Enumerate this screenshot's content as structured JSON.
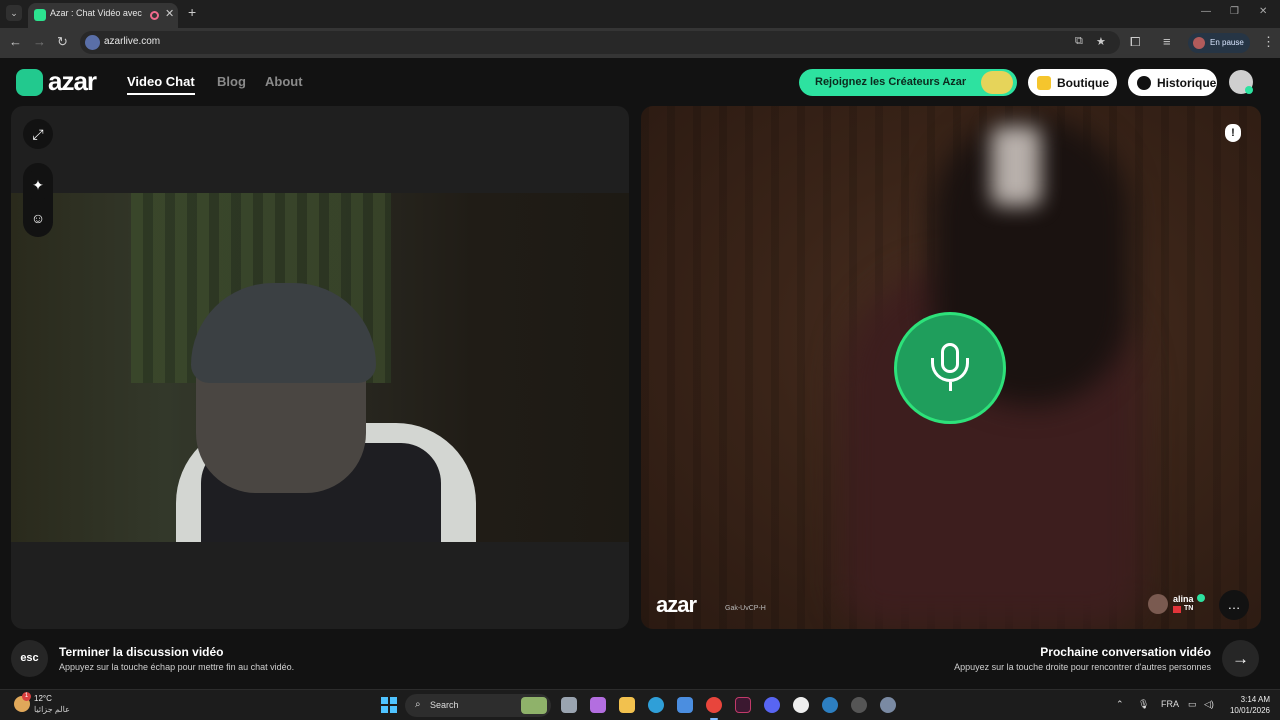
{
  "browser": {
    "tab_title": "Azar : Chat Vidéo avec de n",
    "url": "azarlive.com",
    "profile_status": "En pause"
  },
  "header": {
    "logo": "azar",
    "nav": [
      {
        "label": "Video Chat",
        "active": true
      },
      {
        "label": "Blog",
        "active": false
      },
      {
        "label": "About",
        "active": false
      }
    ],
    "creators_button": "Rejoignez les Créateurs Azar",
    "shop_button": "Boutique",
    "history_button": "Historique"
  },
  "remote": {
    "watermark": "azar",
    "watermark_id": "Gak-UvCP-H",
    "peer_name": "alina",
    "peer_country": "TN"
  },
  "footer": {
    "esc_key": "esc",
    "end_title": "Terminer la discussion vidéo",
    "end_sub": "Appuyez sur la touche échap pour mettre fin au chat vidéo.",
    "next_title": "Prochaine conversation vidéo",
    "next_sub": "Appuyez sur la touche droite pour rencontrer d'autres personnes"
  },
  "taskbar": {
    "weather_temp": "12°C",
    "weather_text": "عالم جزائيا",
    "weather_badge": "1",
    "search_label": "Search",
    "language": "FRA",
    "time": "3:14 AM",
    "date": "10/01/2026"
  },
  "colors": {
    "accent": "#2de2a0",
    "mic_green": "#1f9e5c",
    "background": "#121212"
  }
}
